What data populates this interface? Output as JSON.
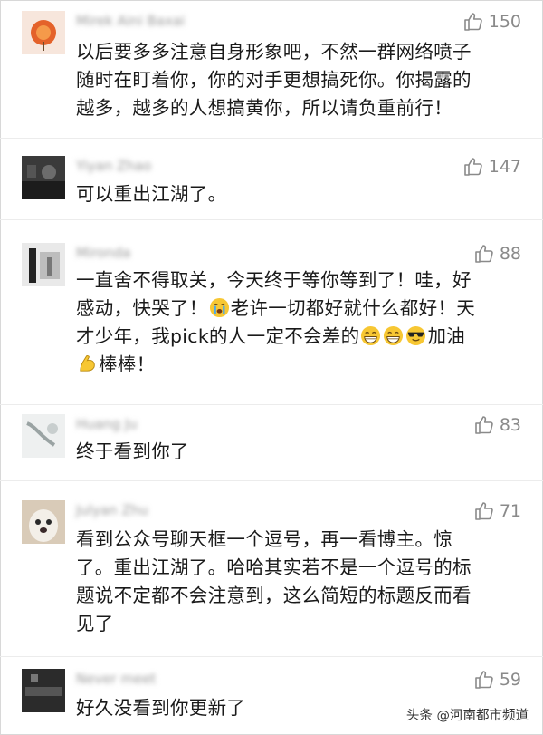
{
  "comments": [
    {
      "author": "Mirek Aini Baxai",
      "likes": "150",
      "lines": [
        "以后要多多注意自身形象吧，不然一群网络喷子",
        "随时在盯着你，你的对手更想搞死你。你揭露的",
        "越多，越多的人想搞黄你，所以请负重前行！"
      ]
    },
    {
      "author": "Yiyan Zhao",
      "likes": "147",
      "lines": [
        "可以重出江湖了。"
      ]
    },
    {
      "author": "Mironda",
      "likes": "88",
      "lines": [
        "一直舍不得取关，今天终于等你等到了！哇，好"
      ],
      "line2_a": "感动，快哭了！",
      "line2_b": "老许一切都好就什么都好！天",
      "line3_a": "才少年，我pick的人一定不会差的",
      "line3_b": "加油",
      "line4": "棒棒！"
    },
    {
      "author": "Huang Ju",
      "likes": "83",
      "lines": [
        "终于看到你了"
      ]
    },
    {
      "author": "Julyan Zhu",
      "likes": "71",
      "lines": [
        "看到公众号聊天框一个逗号，再一看博主。惊",
        "了。重出江湖了。哈哈其实若不是一个逗号的标",
        "题说不定都不会注意到，这么简短的标题反而看",
        "见了"
      ]
    },
    {
      "author": "Never meet",
      "likes": "59",
      "lines": [
        "好久没看到你更新了"
      ]
    }
  ],
  "watermark": "头条 @河南都市频道",
  "icons": {
    "like": "thumbs-up-icon",
    "emoji_cry": "crying-face-emoji",
    "emoji_grin": "grinning-face-emoji",
    "emoji_cool": "sunglasses-face-emoji",
    "emoji_muscle": "flexed-biceps-emoji"
  },
  "colors": {
    "text": "#1a1a1a",
    "meta": "#8a8a8a",
    "separator": "#ececec"
  }
}
